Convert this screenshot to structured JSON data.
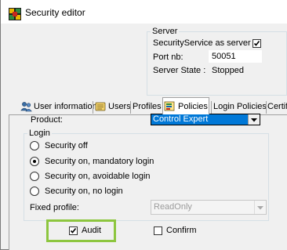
{
  "window": {
    "title": "Security editor",
    "app_icon": "security-editor-app-icon"
  },
  "server": {
    "legend": "Server",
    "service_label": "SecurityService as server",
    "service_checked": true,
    "port_label": "Port nb:",
    "port_value": "50051",
    "state_label": "Server State :",
    "state_value": "Stopped"
  },
  "tabs": [
    {
      "label": "User information",
      "icon": "users-icon"
    },
    {
      "label": "Users",
      "icon": "user-icon"
    },
    {
      "label": "Profiles"
    },
    {
      "label": "Policies",
      "icon": "policies-icon",
      "active": true
    },
    {
      "label": "Login Policies"
    },
    {
      "label": "Certific"
    }
  ],
  "policies": {
    "product_label": "Product:",
    "product_value": "Control Expert",
    "login_legend": "Login",
    "login_options": [
      {
        "label": "Security off",
        "selected": false
      },
      {
        "label": "Security on, mandatory login",
        "selected": true
      },
      {
        "label": "Security on, avoidable login",
        "selected": false
      },
      {
        "label": "Security on, no login",
        "selected": false
      }
    ],
    "fixed_profile_label": "Fixed profile:",
    "fixed_profile_value": "ReadOnly",
    "audit_label": "Audit",
    "audit_checked": true,
    "confirm_label": "Confirm",
    "confirm_checked": false
  },
  "colors": {
    "highlight_box": "#8dc63f",
    "selection": "#0078d7",
    "titlebar": "#ffffff"
  }
}
